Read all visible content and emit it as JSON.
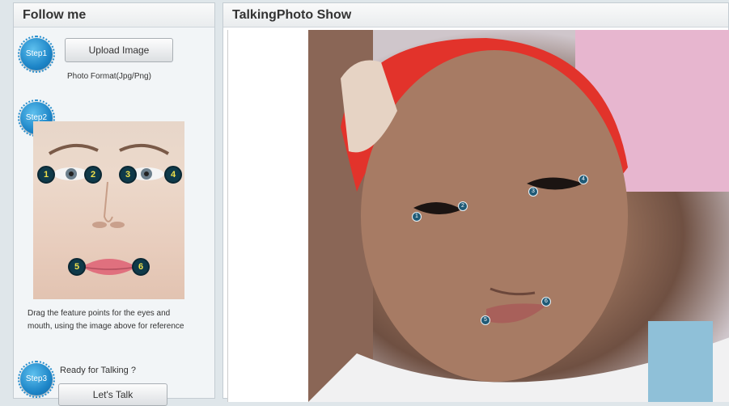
{
  "left_panel": {
    "title": "Follow me",
    "step1": {
      "badge": "Step1",
      "upload_label": "Upload Image",
      "format_note": "Photo Format(Jpg/Png)"
    },
    "step2": {
      "badge": "Step2",
      "point_labels": [
        "1",
        "2",
        "3",
        "4",
        "5",
        "6"
      ],
      "instructions": "Drag the feature points for the eyes and mouth,       using the image above for reference"
    },
    "step3": {
      "badge": "Step3",
      "ready_text": "Ready for Talking ?",
      "talk_label": "Let's Talk"
    }
  },
  "right_panel": {
    "title": "TalkingPhoto Show",
    "photo_points": [
      "1",
      "2",
      "3",
      "4",
      "5",
      "6"
    ]
  }
}
